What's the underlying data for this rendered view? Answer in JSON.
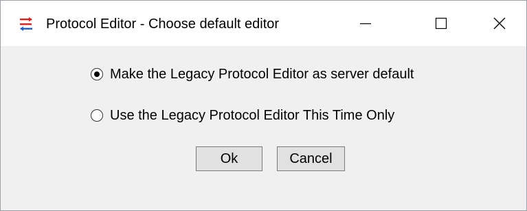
{
  "window": {
    "title": "Protocol Editor - Choose default editor",
    "app_icon": "protocol-editor-icon",
    "controls": [
      "minimize-icon",
      "maximize-icon",
      "close-icon"
    ]
  },
  "options": [
    {
      "label": "Make the Legacy Protocol Editor as server default",
      "selected": true
    },
    {
      "label": "Use the Legacy Protocol Editor This Time Only",
      "selected": false
    }
  ],
  "buttons": {
    "ok_label": "Ok",
    "cancel_label": "Cancel"
  },
  "colors": {
    "app_icon_red": "#e02020",
    "app_icon_blue": "#1f5fd0",
    "titlebar_bg": "#ffffff",
    "dialog_bg": "#f0f0f0"
  }
}
